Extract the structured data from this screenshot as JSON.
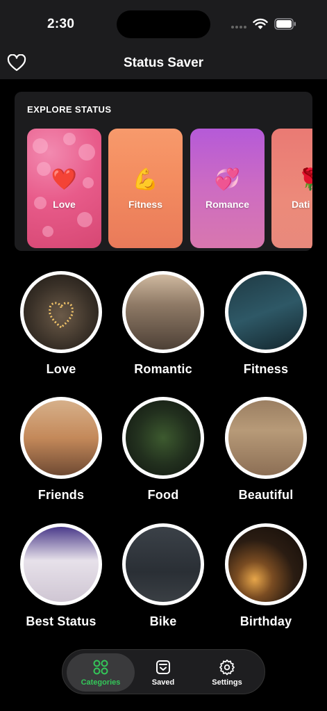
{
  "status_bar": {
    "time": "2:30"
  },
  "nav": {
    "title": "Status Saver"
  },
  "explore": {
    "title": "EXPLORE STATUS",
    "cards": [
      {
        "label": "Love",
        "emoji": "❤️"
      },
      {
        "label": "Fitness",
        "emoji": "💪"
      },
      {
        "label": "Romance",
        "emoji": "💞"
      },
      {
        "label": "Dati",
        "emoji": "🌹"
      }
    ]
  },
  "categories": [
    {
      "label": "Love"
    },
    {
      "label": "Romantic"
    },
    {
      "label": "Fitness"
    },
    {
      "label": "Friends"
    },
    {
      "label": "Food"
    },
    {
      "label": "Beautiful"
    },
    {
      "label": "Best Status"
    },
    {
      "label": "Bike"
    },
    {
      "label": "Birthday"
    }
  ],
  "tabbar": {
    "tabs": [
      {
        "label": "Categories",
        "icon": "categories-icon",
        "active": true
      },
      {
        "label": "Saved",
        "icon": "saved-icon",
        "active": false
      },
      {
        "label": "Settings",
        "icon": "gear-icon",
        "active": false
      }
    ],
    "active_color": "#34c759"
  }
}
